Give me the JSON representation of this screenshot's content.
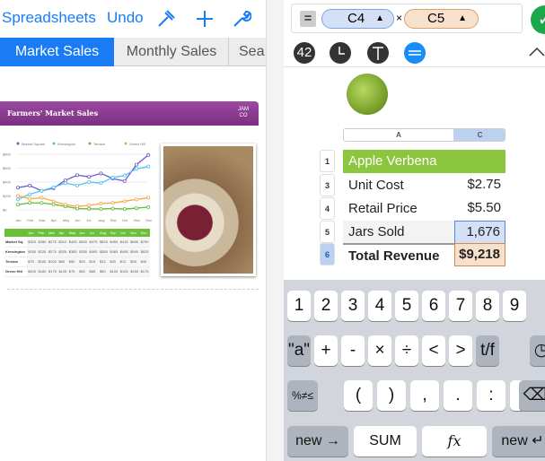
{
  "toolbar": {
    "spreadsheets": "Spreadsheets",
    "undo": "Undo",
    "icons": [
      "hammer-icon",
      "plus-icon",
      "wrench-icon"
    ]
  },
  "tabs": [
    "Market Sales",
    "Monthly Sales",
    "Sea"
  ],
  "sheet": {
    "banner_title": "Farmers' Market Sales",
    "logo": "JAM CO",
    "banner_color": "#8a3b8f",
    "legend": [
      "Market Square",
      "Kensington",
      "Terrace",
      "Green Hill"
    ],
    "months": [
      "Jan",
      "Feb",
      "Mar",
      "Apr",
      "May",
      "Jun",
      "Jul",
      "Aug",
      "Sep",
      "Oct",
      "Nov",
      "Dec"
    ],
    "y_ticks": [
      "$800",
      "$600",
      "$400",
      "$200",
      "$0"
    ],
    "rows": [
      {
        "name": "Market Sq.",
        "values": [
          "$320",
          "$350",
          "$275",
          "$312",
          "$425",
          "$500",
          "$475",
          "$525",
          "$450",
          "$415",
          "$650",
          "$790"
        ]
      },
      {
        "name": "Kensington",
        "values": [
          "$150",
          "$225",
          "$275",
          "$325",
          "$385",
          "$350",
          "$400",
          "$385",
          "$465",
          "$495",
          "$590",
          "$625"
        ]
      },
      {
        "name": "Terrace",
        "values": [
          "$75",
          "$100",
          "$100",
          "$80",
          "$50",
          "$20",
          "$15",
          "$13",
          "$20",
          "$12",
          "$25",
          "$40"
        ]
      },
      {
        "name": "Green Hill",
        "values": [
          "$200",
          "$160",
          "$175",
          "$125",
          "$75",
          "$50",
          "$65",
          "$90",
          "$100",
          "$125",
          "$150",
          "$175"
        ]
      }
    ]
  },
  "formula": {
    "equals": "=",
    "ref1": "C4",
    "op": "×",
    "ref2": "C5",
    "confirm_icon": "checkmark-icon"
  },
  "modes": {
    "number": "42",
    "icons": [
      "number-icon",
      "clock-icon",
      "text-icon",
      "formula-icon"
    ],
    "collapse_icon": "chevron-up-icon"
  },
  "table": {
    "col_a": "A",
    "col_c": "C",
    "title": "Apple Verbena",
    "rows": [
      {
        "num": "1",
        "label": "",
        "value": ""
      },
      {
        "num": "3",
        "label": "Unit Cost",
        "value": "$2.75"
      },
      {
        "num": "4",
        "label": "Retail Price",
        "value": "$5.50"
      },
      {
        "num": "5",
        "label": "Jars Sold",
        "value": "1,676"
      },
      {
        "num": "6",
        "label": "Total Revenue",
        "value": "$9,218"
      }
    ]
  },
  "keyboard": {
    "row1": [
      "1",
      "2",
      "3",
      "4",
      "5",
      "6",
      "7",
      "8",
      "9"
    ],
    "row2": [
      "\"a\"",
      "+",
      "-",
      "×",
      "÷",
      "<",
      ">",
      "t/f"
    ],
    "row3": [
      "%≠≤",
      "(",
      ")",
      ",",
      ".",
      ":",
      "&"
    ],
    "new_right": "new →",
    "sum": "SUM",
    "fx": "fx",
    "new_down": "new ↵"
  }
}
